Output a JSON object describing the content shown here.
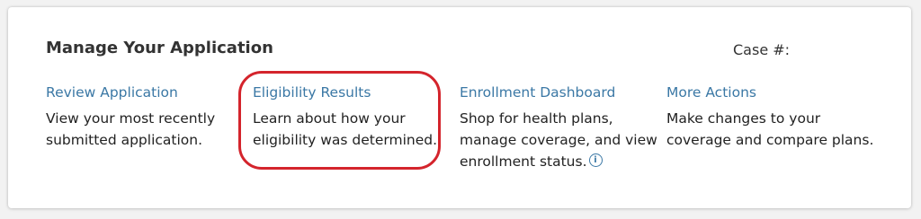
{
  "header": {
    "title": "Manage Your Application",
    "case_label": "Case #:"
  },
  "columns": [
    {
      "link": "Review Application",
      "desc_lines": [
        "View your most recently",
        "submitted application."
      ]
    },
    {
      "link": "Eligibility Results",
      "desc_lines": [
        "Learn about how your",
        "eligibility was determined."
      ]
    },
    {
      "link": "Enrollment Dashboard",
      "desc_lines": [
        "Shop for health plans,",
        "manage coverage, and view",
        "enrollment status."
      ]
    },
    {
      "link": "More Actions",
      "desc_lines": [
        "Make changes to your",
        "coverage and compare plans."
      ]
    }
  ],
  "info_icon": "info-circle-icon",
  "colors": {
    "link": "#3b78a5",
    "highlight": "#d4242c",
    "text": "#222222"
  }
}
